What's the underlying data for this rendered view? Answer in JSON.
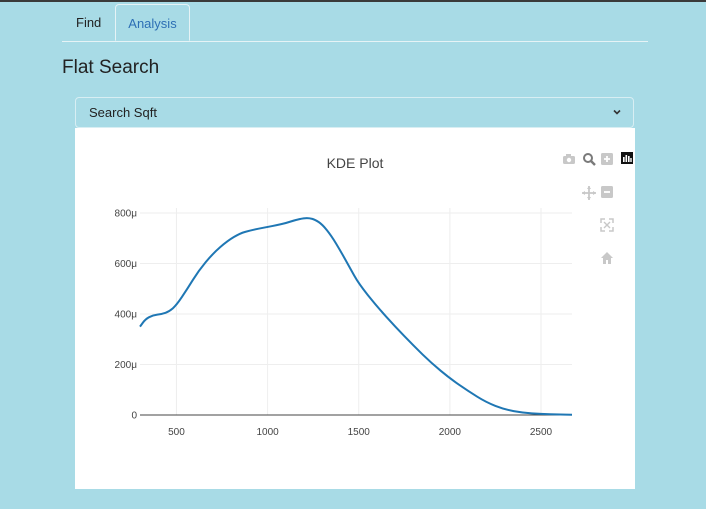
{
  "tabs": [
    {
      "label": "Find"
    },
    {
      "label": "Analysis"
    }
  ],
  "page_title": "Flat Search",
  "dropdown": {
    "label": "Search Sqft"
  },
  "chart_data": {
    "type": "line",
    "title": "KDE Plot",
    "xlabel": "",
    "ylabel": "",
    "xlim": [
      300,
      2670
    ],
    "ylim": [
      0,
      0.00082
    ],
    "x_ticks": [
      {
        "value": 500,
        "label": "500"
      },
      {
        "value": 1000,
        "label": "1000"
      },
      {
        "value": 1500,
        "label": "1500"
      },
      {
        "value": 2000,
        "label": "2000"
      },
      {
        "value": 2500,
        "label": "2500"
      }
    ],
    "y_ticks": [
      {
        "value": 0,
        "label": "0"
      },
      {
        "value": 0.0002,
        "label": "200μ"
      },
      {
        "value": 0.0004,
        "label": "400μ"
      },
      {
        "value": 0.0006,
        "label": "600μ"
      },
      {
        "value": 0.0008,
        "label": "800μ"
      }
    ],
    "grid": true,
    "series": [
      {
        "color": "#1f77b4",
        "x": [
          300,
          330,
          370,
          420,
          460,
          500,
          560,
          620,
          700,
          780,
          850,
          900,
          950,
          1000,
          1050,
          1100,
          1150,
          1200,
          1230,
          1260,
          1300,
          1350,
          1400,
          1450,
          1500,
          1600,
          1700,
          1800,
          1900,
          2000,
          2100,
          2200,
          2300,
          2400,
          2500,
          2600,
          2670
        ],
        "y": [
          0.00035,
          0.00038,
          0.000395,
          0.0004,
          0.00041,
          0.000435,
          0.0005,
          0.00057,
          0.00064,
          0.00069,
          0.00072,
          0.00073,
          0.000738,
          0.000745,
          0.000752,
          0.00076,
          0.000772,
          0.00078,
          0.00078,
          0.000774,
          0.000755,
          0.00071,
          0.00065,
          0.000585,
          0.00052,
          0.00043,
          0.00035,
          0.000275,
          0.000205,
          0.000145,
          9.5e-05,
          5e-05,
          2.2e-05,
          9e-06,
          4e-06,
          2e-06,
          1e-06
        ]
      }
    ]
  },
  "modebar": [
    {
      "icon": "camera-icon"
    },
    {
      "icon": "zoom-icon"
    },
    {
      "icon": "zoom-in-icon"
    },
    {
      "icon": "plotly-logo-icon"
    },
    {
      "icon": "pan-icon"
    },
    {
      "icon": "zoom-out-icon"
    },
    {
      "icon": "autoscale-icon"
    },
    {
      "icon": "home-icon"
    }
  ]
}
